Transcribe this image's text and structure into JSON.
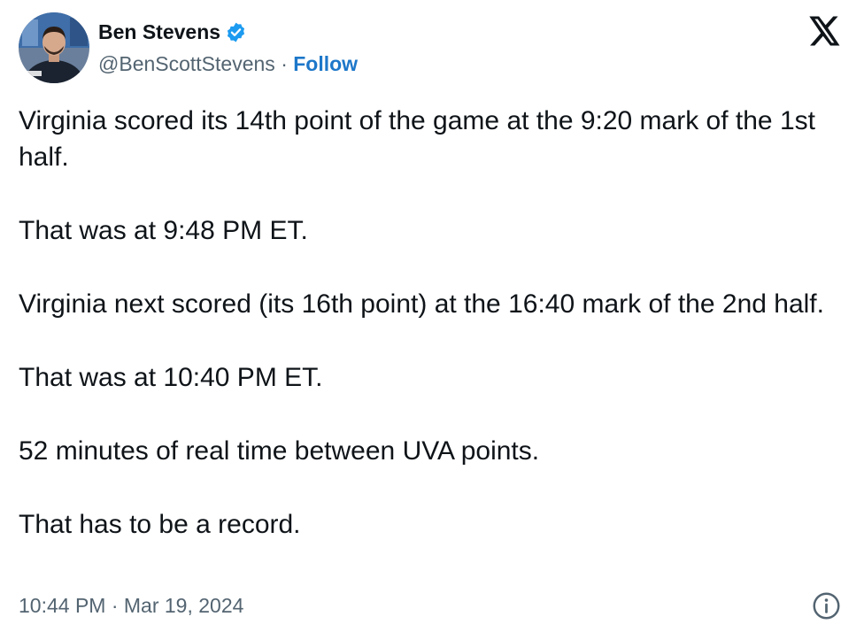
{
  "author": {
    "name": "Ben Stevens",
    "handle": "@BenScottStevens",
    "separator": "·",
    "follow_label": "Follow",
    "verified": true
  },
  "icons": {
    "verified": "verified-badge-icon",
    "logo": "x-logo-icon",
    "info": "info-icon"
  },
  "colors": {
    "text": "#0f1419",
    "secondary": "#536471",
    "accent": "#1d77c9",
    "verified": "#1d9bf0"
  },
  "tweet": {
    "paragraphs": [
      "Virginia scored its 14th point of the game at the 9:20 mark of the 1st half.",
      "That was at 9:48 PM ET.",
      "Virginia next scored (its 16th point) at the 16:40 mark of the 2nd half.",
      "That was at 10:40 PM ET.",
      "52 minutes of real time between UVA points.",
      "That has to be a record."
    ],
    "timestamp": "10:44 PM · Mar 19, 2024"
  }
}
